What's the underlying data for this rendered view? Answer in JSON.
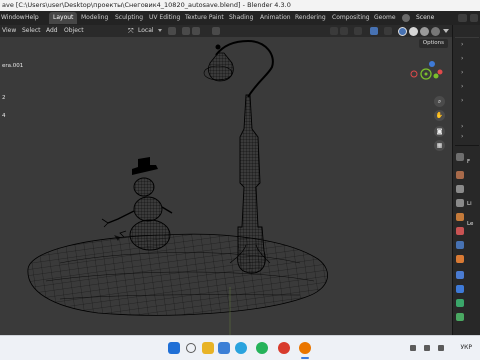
{
  "window": {
    "title": "ave [C:\\Users\\user\\Desktop\\проекты\\Снеговик4_10820_autosave.blend] - Blender 4.3.0"
  },
  "menu": {
    "items": [
      "Window",
      "Help"
    ]
  },
  "workspaces": {
    "tabs": [
      "Layout",
      "Modeling",
      "Sculpting",
      "UV Editing",
      "Texture Paint",
      "Shading",
      "Animation",
      "Rendering",
      "Compositing",
      "Geome"
    ],
    "active": "Layout",
    "scene_label": "Scene"
  },
  "viewport_header": {
    "view": "View",
    "select": "Select",
    "add": "Add",
    "object": "Object",
    "transform_orientation": "Local"
  },
  "viewport": {
    "overlay_lines": [
      "era.001",
      "2",
      "4"
    ],
    "options_label": "Options",
    "shading_mode": "wireframe",
    "gizmo_axes": {
      "x": "#e14a4a",
      "y": "#7bbf2c",
      "z": "#3e7ad8"
    }
  },
  "outliner": {
    "side_letters": [
      "F",
      "Li",
      "Le"
    ]
  },
  "taskbar": {
    "apps": [
      {
        "icon": "windows-start-icon",
        "color": "#1f6fd6"
      },
      {
        "icon": "search-icon",
        "color": "#5a5a5a"
      },
      {
        "icon": "file-explorer-icon",
        "color": "#e8b326"
      },
      {
        "icon": "image-viewer-icon",
        "color": "#3c7fd6"
      },
      {
        "icon": "telegram-icon",
        "color": "#2aa3de"
      },
      {
        "icon": "whatsapp-icon",
        "color": "#25b35a"
      },
      {
        "icon": "chrome-icon",
        "color": "#d83b2d"
      },
      {
        "icon": "blender-icon",
        "color": "#ea7600"
      }
    ],
    "language": "УКР"
  }
}
